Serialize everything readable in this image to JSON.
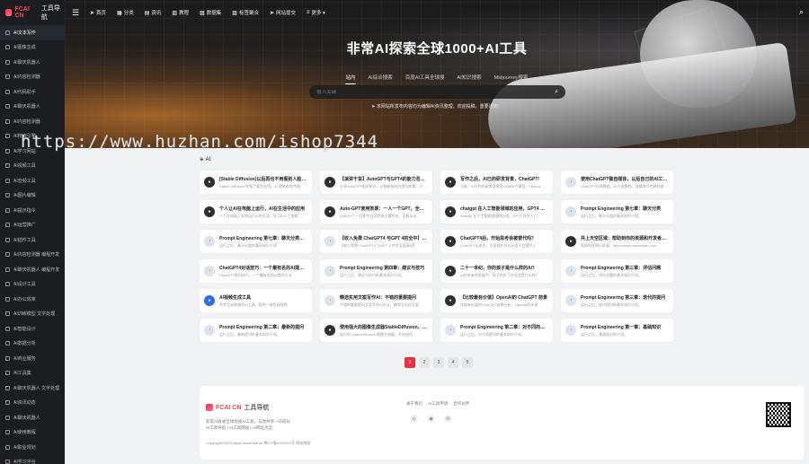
{
  "brand": {
    "fcai": "FCAI CN",
    "rest": "工具导航"
  },
  "sidebar": {
    "items": [
      {
        "label": "AI文本写作"
      },
      {
        "label": "AI图像生成"
      },
      {
        "label": "AI聊天机器人"
      },
      {
        "label": "AI内容检测器"
      },
      {
        "label": "AI代码助手"
      },
      {
        "label": "AI聊天机器人"
      },
      {
        "label": "AI内容检测器"
      },
      {
        "label": "AI搜索引擎"
      },
      {
        "label": "AI学习网站"
      },
      {
        "label": "AI视频工具"
      },
      {
        "label": "AI音频工具"
      },
      {
        "label": "AI图片编辑"
      },
      {
        "label": "AI提示指令"
      },
      {
        "label": "AI运营推广"
      },
      {
        "label": "AI插件工具"
      },
      {
        "label": "AI内容检测器 编程开发"
      },
      {
        "label": "AI聊天机器人 编程开发"
      },
      {
        "label": "AI设计工具"
      },
      {
        "label": "AI办公效率"
      },
      {
        "label": "AI训练模型 文字处理"
      },
      {
        "label": "AI智能设计"
      },
      {
        "label": "AI数据分析"
      },
      {
        "label": "AI商业服务"
      },
      {
        "label": "AI工具集"
      },
      {
        "label": "AI聊天机器人 文字处理"
      },
      {
        "label": "AI资讯动态"
      },
      {
        "label": "AI聊天机器人"
      },
      {
        "label": "AI使用教程"
      },
      {
        "label": "AI职业规划"
      },
      {
        "label": "AI学习平台"
      },
      {
        "label": "AI开放社区"
      }
    ]
  },
  "topnav": {
    "items": [
      {
        "icon": "send-icon",
        "label": "首页"
      },
      {
        "icon": "grid-icon",
        "label": "分类"
      },
      {
        "icon": "news-icon",
        "label": "资讯"
      },
      {
        "icon": "book-icon",
        "label": "教程"
      },
      {
        "icon": "chart-icon",
        "label": "数据集"
      },
      {
        "icon": "gift-icon",
        "label": "标签聚合"
      },
      {
        "icon": "send2-icon",
        "label": "网站提交"
      },
      {
        "icon": "more-icon",
        "label": "更多 ▾"
      }
    ]
  },
  "hero": {
    "title": "非常AI探索全球1000+AI工具",
    "tabs": [
      "站内",
      "AI综合搜索",
      "百度AI工具全球搜",
      "AI知识搜索",
      "Midjourney搜索"
    ],
    "search_placeholder": "输入关键",
    "notice": "本网站所发布内容均为编辑AI资讯整理，欢迎投稿，重要通知！"
  },
  "watermark": "https://www.huzhan.com/ishop7344",
  "main": {
    "section_label": "AI",
    "cards": [
      {
        "title": "[Stable Diffusion]以后再也不用看别人脸色了",
        "desc": "Stable Diffusion 学到了某些东西，AI 就能帮你作图",
        "thumb": "dark"
      },
      {
        "title": "【演讲干货】AutoGPT与GPT4的能力吾可及",
        "desc": "分享AutoGPT相关知识，AI智能体的应用与前景，已经…",
        "thumb": "dark"
      },
      {
        "title": "写作之后，AI已的研发背景，ChatGPT!",
        "desc": "当前，AI写作的研发背景是ChatGPT模型，OpenAI 等AI…",
        "thumb": "dark"
      },
      {
        "title": "使用ChatGPT做自媒体，以后自己的AI工具教程",
        "desc": "ChatGPT问答教程，AI工具教程，自媒体写作教程使用…",
        "thumb": "light"
      },
      {
        "title": "个人让AI在电脑上运行，AI在生活中的应用",
        "desc": "一个在电脑上本地运行AI的方法，学习AI人工智能…",
        "thumb": "dark"
      },
      {
        "title": "Auto-GPT使用效果：一人一个GPT，全新玩法",
        "desc": "AutoGPT 一行命令自动完成大量任务，全新玩法…",
        "thumb": "dark"
      },
      {
        "title": "chatgpt 在人工智能领域的应用，GPT4 算法入门",
        "desc": "chatgpt 在人工智能领域的应用，GPT4 技术入门…",
        "thumb": "dark"
      },
      {
        "title": "Prompt Engineering 第七章：聊天分类",
        "desc": "运行之后，聊天分类的基本知识介绍。",
        "thumb": "light"
      },
      {
        "title": "Prompt Engineering 第七章：聊天分类的方法",
        "desc": "运行之后，聊天分类的基本知识介绍",
        "thumb": "light"
      },
      {
        "title": "【收入免费 ChatGPT4 与GPT 4的全中】中文",
        "desc": "【收入免费 ChatGPT4 与GPT 4 中文全面调试】",
        "thumb": "light"
      },
      {
        "title": "ChatGPT4后，开始思考会被替代吗？",
        "desc": "ChatGPT出来后，大家都在讨论AI会不会替代人",
        "thumb": "dark"
      },
      {
        "title": "共上天空区域：帮助到你的资源和开发者的工具",
        "desc": "帮助你找到AI资源，https://www.aitoolsapp.com",
        "thumb": "dark"
      },
      {
        "title": "ChatGPT4对话技巧：一个最有名的AI提问方法",
        "desc": "ChatGPT提问技巧，一个最有名的AI提问方法",
        "thumb": "light"
      },
      {
        "title": "Prompt Engineering 第四章：建议与技巧",
        "desc": "运行之后，建议与技巧的基本知识介绍。",
        "thumb": "light"
      },
      {
        "title": "二十一世纪，你的孩子是什么样的AI？",
        "desc": "AI在未来的发展中，孩子的学习方式会是什么样？",
        "thumb": "dark"
      },
      {
        "title": "Prompt Engineering 第三章：评估问题",
        "desc": "运行之后，评估问题的基本知识介绍。",
        "thumb": "light"
      },
      {
        "title": "AI视频生成工具",
        "desc": "文字生成视频的AI工具，帮你一键生成视频",
        "thumb": "blue"
      },
      {
        "title": "精选实用文案写作AI：不错的重要提问",
        "desc": "不错的重要提问文案写作AI方法，教你写出好文案",
        "thumb": "light"
      },
      {
        "title": "【比较最有价值】OpenAI的 ChatGPT 前景",
        "desc": "比较有价值的ChatGPT前景分析，OpenAI的未来",
        "thumb": "dark"
      },
      {
        "title": "Prompt Engineering 第三章：迭代的提问",
        "desc": "运行之后，迭代提问的基本知识介绍。",
        "thumb": "light"
      },
      {
        "title": "Prompt Engineering 第二章：最新的提问",
        "desc": "运行之后，最新提问的基本知识介绍。",
        "thumb": "light"
      },
      {
        "title": "使用强大的图像生成器StableDiffusion，开启创作",
        "desc": "强大的 StableDiffusion 图像生成器，开启创作…",
        "thumb": "dark"
      },
      {
        "title": "Prompt Engineering 第二章：对不同的提问",
        "desc": "运行之后，对不同提问的基本知识介绍。",
        "thumb": "light"
      },
      {
        "title": "Prompt Engineering 第一章：基础知识",
        "desc": "运行之后，基础知识的介绍。",
        "thumb": "light"
      }
    ]
  },
  "pager": {
    "pages": [
      "1",
      "2",
      "3",
      "4",
      "5"
    ],
    "active": "1"
  },
  "footer": {
    "desc1": "非常AI收录全球优质AI工具，与你共享一同成长",
    "desc2": "AI工具导航 | AI工具网站 | AI网址大全",
    "copyright": "Copyright©2023 https://www.fcai.cn 粤ICP备XXXXXX号 网站地图",
    "links": [
      "关于我们",
      "AI工具申请",
      "合作伙伴"
    ]
  }
}
